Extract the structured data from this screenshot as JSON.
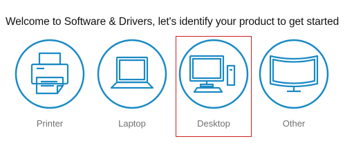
{
  "heading": "Welcome to Software & Drivers, let's identify your product to get started",
  "products": [
    {
      "label": "Printer",
      "icon": "printer-icon",
      "selected": false
    },
    {
      "label": "Laptop",
      "icon": "laptop-icon",
      "selected": false
    },
    {
      "label": "Desktop",
      "icon": "desktop-icon",
      "selected": true
    },
    {
      "label": "Other",
      "icon": "monitor-icon",
      "selected": false
    }
  ],
  "colors": {
    "icon_blue": "#1a8ac4",
    "selection_border": "#cc1f1f",
    "label_gray": "#707070"
  }
}
